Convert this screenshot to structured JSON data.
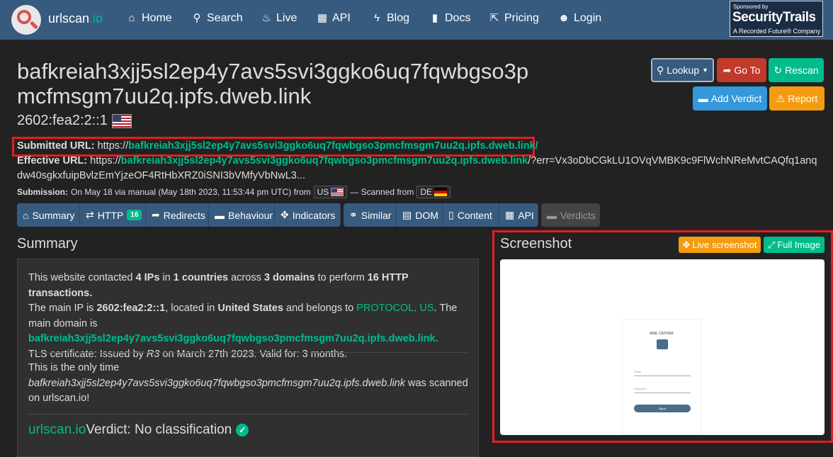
{
  "nav": {
    "brand_main": "urlscan",
    "brand_io": ".io",
    "items": [
      {
        "label": "Home",
        "icon": "home-icon"
      },
      {
        "label": "Search",
        "icon": "search-icon"
      },
      {
        "label": "Live",
        "icon": "fire-icon"
      },
      {
        "label": "API",
        "icon": "qrcode-icon"
      },
      {
        "label": "Blog",
        "icon": "bolt-icon"
      },
      {
        "label": "Docs",
        "icon": "bookmark-icon"
      },
      {
        "label": "Pricing",
        "icon": "external-link-icon"
      },
      {
        "label": "Login",
        "icon": "user-icon"
      }
    ],
    "sponsor_top": "Sponsored by",
    "sponsor_name": "SecurityTrails",
    "sponsor_sub": "A Recorded Future® Company"
  },
  "header": {
    "title_line1": "bafkreiah3xjj5sl2ep4y7avs5svi3ggko6uq7fqwbgso3p",
    "title_line2": "mcfmsgm7uu2q.ipfs.dweb.link",
    "ip": "2602:fea2:2::1"
  },
  "actions": {
    "lookup": "Lookup",
    "goto": "Go To",
    "rescan": "Rescan",
    "add_verdict": "Add Verdict",
    "report": "Report"
  },
  "details": {
    "submitted_label": "Submitted URL:",
    "submitted_scheme": "https://",
    "submitted_host": "bafkreiah3xjj5sl2ep4y7avs5svi3ggko6uq7fqwbgso3pmcfmsgm7uu2q.ipfs.dweb.link/",
    "effective_label": "Effective URL:",
    "effective_scheme": "https://",
    "effective_host": "bafkreiah3xjj5sl2ep4y7avs5svi3ggko6uq7fqwbgso3pmcfmsgm7uu2q.ipfs.dweb.link",
    "effective_rest1": "/?err=Vx3oDbCGkLU1OVqVMBK9c9FlWchNReMvtCAQfq1anq",
    "effective_rest2": "dw40sgkxfuipBvlzEmYjzeOF4RtHbXRZ0iSNI3bVMfyVbNwL3...",
    "submission_label": "Submission:",
    "submission_text": "On May 18 via manual (May 18th 2023, 11:53:44 pm UTC) from",
    "from_country": "US",
    "scanned_from_text": "— Scanned from",
    "scanned_country": "DE"
  },
  "tabs": {
    "summary": "Summary",
    "http": "HTTP",
    "http_count": "16",
    "redirects": "Redirects",
    "behaviour": "Behaviour",
    "indicators": "Indicators",
    "similar": "Similar",
    "dom": "DOM",
    "content": "Content",
    "api": "API",
    "verdicts": "Verdicts"
  },
  "summary": {
    "heading": "Summary",
    "p1_a": "This website contacted ",
    "p1_ips": "4 IPs",
    "p1_b": " in ",
    "p1_countries": "1 countries",
    "p1_c": " across ",
    "p1_domains": "3 domains",
    "p1_d": " to perform ",
    "p1_tx": "16 HTTP transactions.",
    "p1_e": "The main IP is ",
    "p1_ip": "2602:fea2:2::1",
    "p1_f": ", located in ",
    "p1_country": "United States",
    "p1_g": " and belongs to ",
    "p1_asn": "PROTOCOL, US",
    "p1_h": ". The main domain is",
    "p1_domain": "bafkreiah3xjj5sl2ep4y7avs5svi3ggko6uq7fqwbgso3pmcfmsgm7uu2q.ipfs.dweb.link.",
    "p1_tls_a": "TLS certificate: Issued by ",
    "p1_tls_issuer": "R3",
    "p1_tls_b": " on March 27th 2023. Valid for: 3 months.",
    "p2_a": "This is the only time",
    "p2_domain": "bafkreiah3xjj5sl2ep4y7avs5svi3ggko6uq7fqwbgso3pmcfmsgm7uu2q.ipfs.dweb.link",
    "p2_b": " was scanned",
    "p2_c": "on urlscan.io!",
    "verdict_brand": "urlscan.io",
    "verdict_text": " Verdict: No classification"
  },
  "screenshot": {
    "heading": "Screenshot",
    "live_btn": "Live screenshot",
    "full_btn": "Full Image",
    "mini_title": "MAIL CENTER",
    "mini_email": "Email",
    "mini_password": "Password",
    "mini_button": "Signin"
  }
}
